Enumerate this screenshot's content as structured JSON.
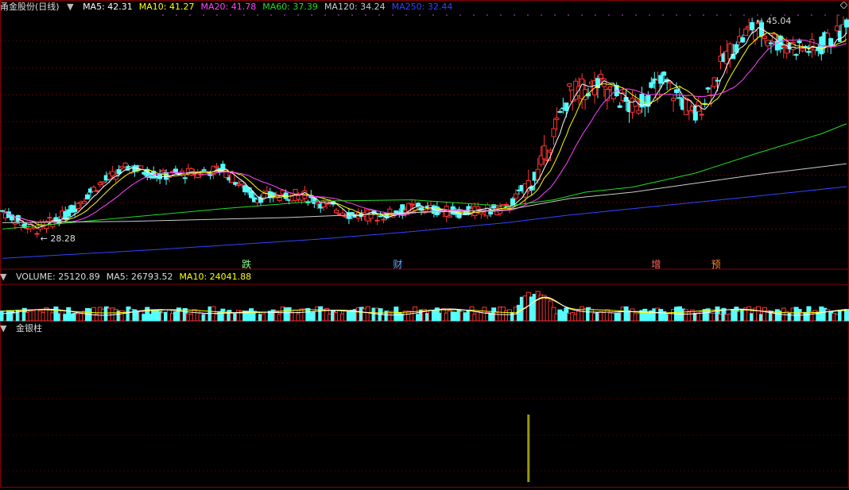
{
  "stock": {
    "name": "甬金股份(日线)"
  },
  "ma_legend": [
    {
      "label": "MA5: 42.31",
      "color": "#ffffff"
    },
    {
      "label": "MA10: 41.27",
      "color": "#ffff00"
    },
    {
      "label": "MA20: 41.78",
      "color": "#ff44ff"
    },
    {
      "label": "MA60: 37.39",
      "color": "#22dd22"
    },
    {
      "label": "MA120: 34.24",
      "color": "#cccccc"
    },
    {
      "label": "MA250: 32.44",
      "color": "#3344ff"
    }
  ],
  "volume_legend": [
    {
      "label": "VOLUME: 25120.89",
      "color": "#dddddd"
    },
    {
      "label": "MA5: 26793.52",
      "color": "#dddddd"
    },
    {
      "label": "MA10: 24041.88",
      "color": "#ffff00"
    }
  ],
  "indicator": {
    "name": "金银柱"
  },
  "colors": {
    "up": "#ff3333",
    "down": "#54ffff",
    "grid": "#8b0000",
    "indicator_bar": "#999900"
  },
  "chart_data": {
    "type": "candlestick",
    "price_range": [
      27,
      46
    ],
    "high_label": "45.04",
    "low_label": "28.28",
    "events": [
      {
        "label": "跌",
        "color": "#88ff88",
        "bar": 76
      },
      {
        "label": "财",
        "color": "#66aaff",
        "bar": 124
      },
      {
        "label": "增",
        "color": "#ff6666",
        "bar": 206
      },
      {
        "label": "预",
        "color": "#ff8833",
        "bar": 225
      }
    ],
    "ma_lines": [
      {
        "name": "MA60",
        "color": "#22dd22",
        "points": [
          [
            0,
            29.1
          ],
          [
            30,
            29.8
          ],
          [
            70,
            30.7
          ],
          [
            100,
            31.3
          ],
          [
            130,
            31.4
          ],
          [
            160,
            30.9
          ],
          [
            175,
            31.4
          ],
          [
            185,
            32.0
          ],
          [
            200,
            32.4
          ],
          [
            220,
            33.5
          ],
          [
            240,
            35.1
          ],
          [
            260,
            36.6
          ],
          [
            268,
            37.39
          ]
        ]
      },
      {
        "name": "MA120",
        "color": "#cccccc",
        "points": [
          [
            0,
            29.6
          ],
          [
            40,
            29.7
          ],
          [
            90,
            30.0
          ],
          [
            130,
            30.4
          ],
          [
            160,
            30.6
          ],
          [
            180,
            31.5
          ],
          [
            200,
            32.0
          ],
          [
            220,
            32.7
          ],
          [
            240,
            33.4
          ],
          [
            268,
            34.24
          ]
        ]
      },
      {
        "name": "MA250",
        "color": "#3344ff",
        "points": [
          [
            0,
            26.8
          ],
          [
            50,
            27.5
          ],
          [
            100,
            28.3
          ],
          [
            130,
            28.9
          ],
          [
            160,
            29.6
          ],
          [
            180,
            30.2
          ],
          [
            200,
            30.7
          ],
          [
            220,
            31.2
          ],
          [
            240,
            31.7
          ],
          [
            268,
            32.44
          ]
        ]
      }
    ],
    "indicator_bars": [
      {
        "bar": 167,
        "value": 1
      }
    ]
  }
}
